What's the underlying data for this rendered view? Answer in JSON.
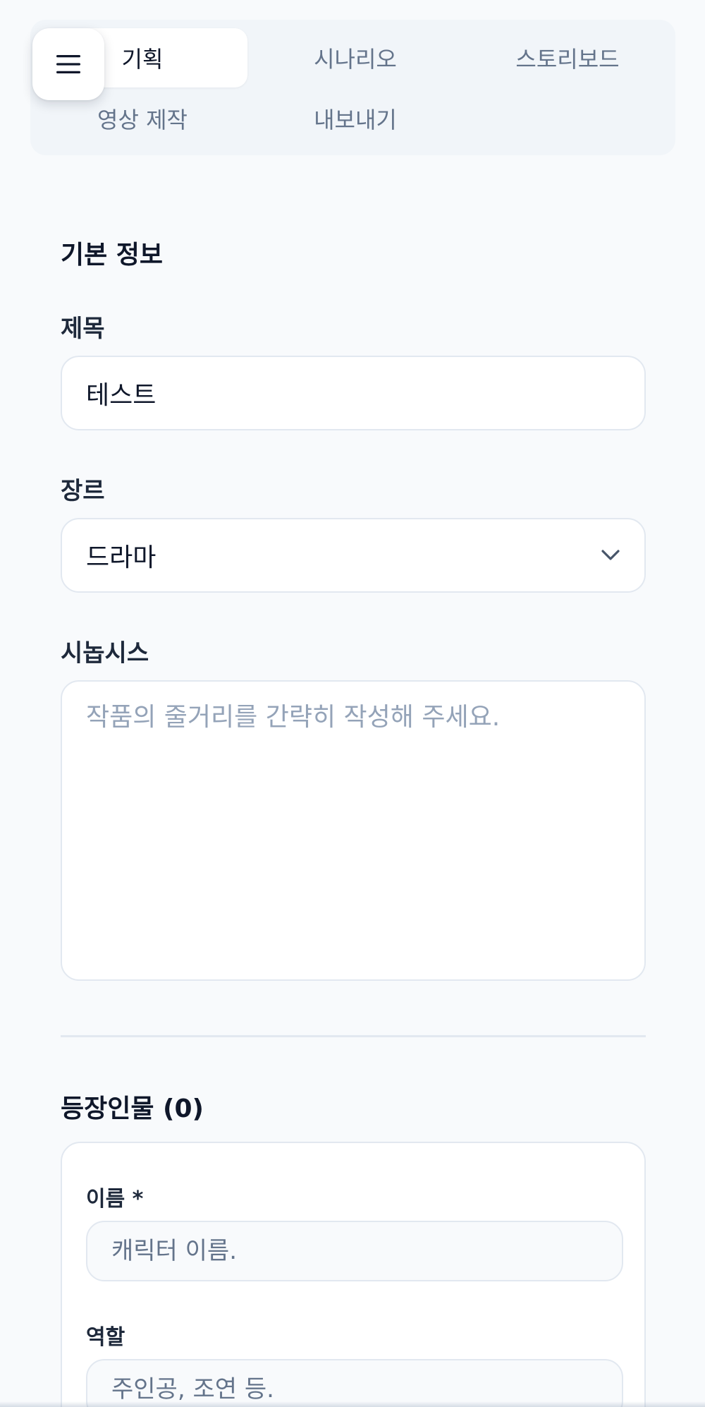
{
  "tabs": [
    {
      "label": "기획",
      "active": true
    },
    {
      "label": "시나리오",
      "active": false
    },
    {
      "label": "스토리보드",
      "active": false
    },
    {
      "label": "영상 제작",
      "active": false
    },
    {
      "label": "내보내기",
      "active": false
    }
  ],
  "basic_info": {
    "section_title": "기본 정보",
    "title_label": "제목",
    "title_value": "테스트",
    "genre_label": "장르",
    "genre_value": "드라마",
    "synopsis_label": "시놉시스",
    "synopsis_placeholder": "작품의 줄거리를 간략히 작성해 주세요."
  },
  "characters": {
    "section_title": "등장인물 (0)",
    "name_label": "이름 *",
    "name_placeholder": "캐릭터 이름.",
    "role_label": "역할",
    "role_placeholder": "주인공, 조연 등."
  },
  "icons": {
    "menu": "hamburger-menu-icon",
    "genre_dropdown": "chevron-down-icon"
  },
  "colors": {
    "background": "#f8fafc",
    "tab_panel": "#f1f5f9",
    "active_tab": "#ffffff",
    "text_primary": "#0f172a",
    "text_muted": "#64748b",
    "border": "#e2e8f0",
    "placeholder": "#94a3b8"
  }
}
